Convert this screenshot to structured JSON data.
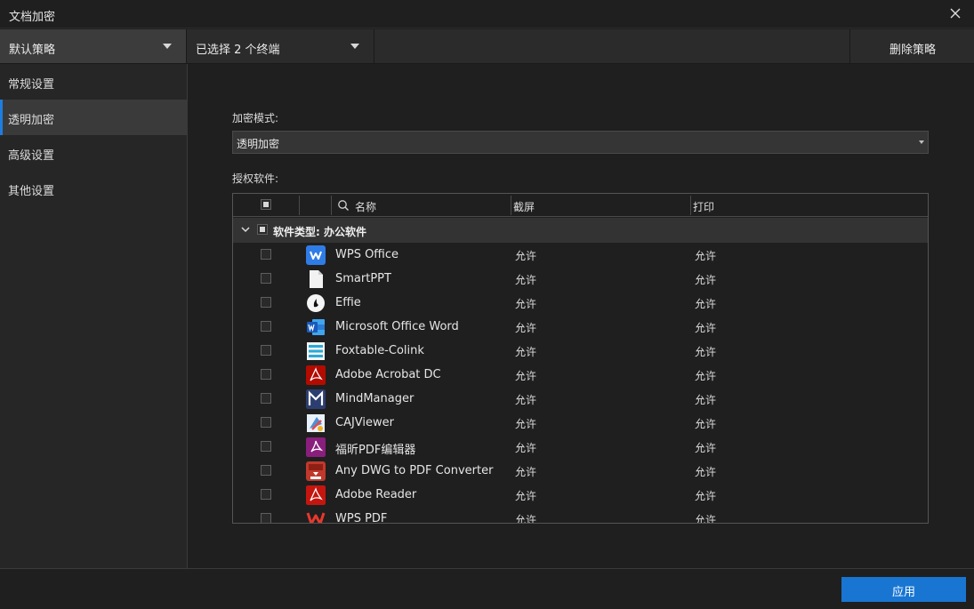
{
  "window": {
    "title": "文档加密"
  },
  "toolbar": {
    "policy": "默认策略",
    "terminals": "已选择 2 个终端",
    "delete_label": "删除策略"
  },
  "sidebar": {
    "items": [
      {
        "label": "常规设置"
      },
      {
        "label": "透明加密"
      },
      {
        "label": "高级设置"
      },
      {
        "label": "其他设置"
      }
    ],
    "active_index": 1
  },
  "main": {
    "mode_label": "加密模式:",
    "mode_value": "透明加密",
    "software_label": "授权软件:"
  },
  "table": {
    "columns": {
      "name": "名称",
      "screenshot": "截屏",
      "print": "打印"
    },
    "group": "软件类型: 办公软件",
    "rows": [
      {
        "name": "WPS Office",
        "screenshot": "允许",
        "print": "允许",
        "icon": "wps-office-icon"
      },
      {
        "name": "SmartPPT",
        "screenshot": "允许",
        "print": "允许",
        "icon": "smartppt-file-icon"
      },
      {
        "name": "Effie",
        "screenshot": "允许",
        "print": "允许",
        "icon": "effie-icon"
      },
      {
        "name": "Microsoft Office Word",
        "screenshot": "允许",
        "print": "允许",
        "icon": "word-icon"
      },
      {
        "name": "Foxtable-Colink",
        "screenshot": "允许",
        "print": "允许",
        "icon": "foxtable-icon"
      },
      {
        "name": "Adobe Acrobat DC",
        "screenshot": "允许",
        "print": "允许",
        "icon": "acrobat-icon"
      },
      {
        "name": "MindManager",
        "screenshot": "允许",
        "print": "允许",
        "icon": "mindmanager-icon"
      },
      {
        "name": "CAJViewer",
        "screenshot": "允许",
        "print": "允许",
        "icon": "cajviewer-icon"
      },
      {
        "name": "福昕PDF编辑器",
        "screenshot": "允许",
        "print": "允许",
        "icon": "foxit-pdf-icon"
      },
      {
        "name": "Any DWG to PDF Converter",
        "screenshot": "允许",
        "print": "允许",
        "icon": "dwg-pdf-icon"
      },
      {
        "name": "Adobe Reader",
        "screenshot": "允许",
        "print": "允许",
        "icon": "adobe-reader-icon"
      },
      {
        "name": "WPS PDF",
        "screenshot": "允许",
        "print": "允许",
        "icon": "wps-pdf-icon"
      }
    ]
  },
  "footer": {
    "apply_label": "应用"
  },
  "colors": {
    "accent": "#1876d2",
    "background": "#1f1f1f"
  }
}
